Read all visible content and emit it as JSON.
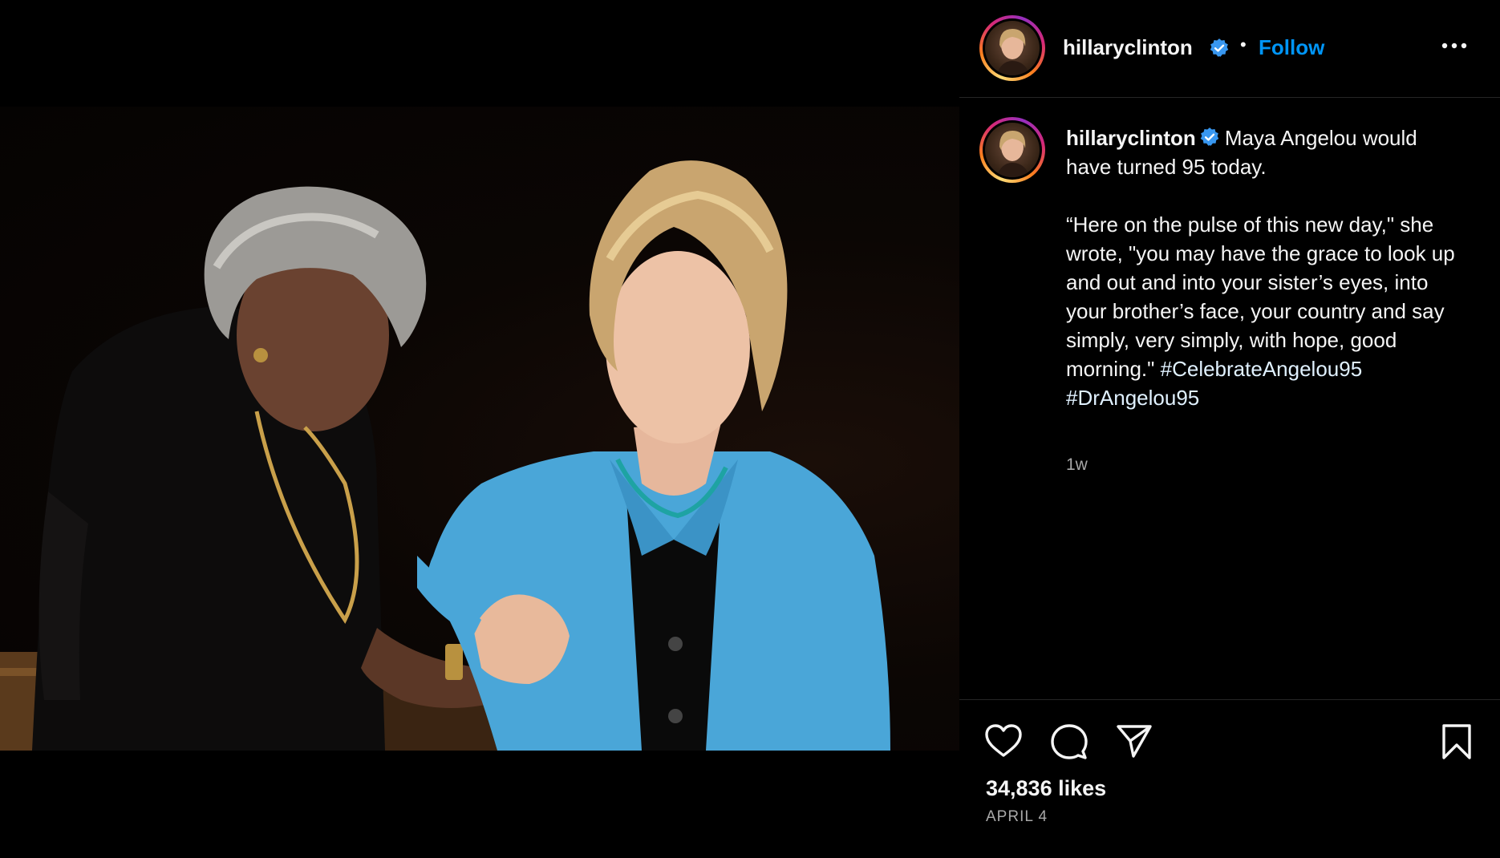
{
  "post": {
    "username": "hillaryclinton",
    "separator": "•",
    "follow_label": "Follow",
    "caption": {
      "username": "hillaryclinton",
      "line1": "Maya Angelou would have turned 95 today.",
      "quote": "“Here on the pulse of this new day,\" she wrote, \"you may have the grace to look up and out and into your sister’s eyes, into your brother’s face, your country and say simply, very simply, with hope, good morning.\"",
      "hashtag1": "#CelebrateAngelou95",
      "hashtag2": "#DrAngelou95"
    },
    "time_ago": "1w",
    "likes": "34,836 likes",
    "date": "APRIL 4"
  },
  "icons": {
    "verified": "verified-badge-icon",
    "more": "more-options-icon",
    "like": "heart-icon",
    "comment": "comment-icon",
    "share": "share-icon",
    "save": "bookmark-icon"
  },
  "colors": {
    "follow": "#0095f6",
    "verified": "#3897f0",
    "secondary_text": "#a8a8a8",
    "divider": "#262626"
  }
}
